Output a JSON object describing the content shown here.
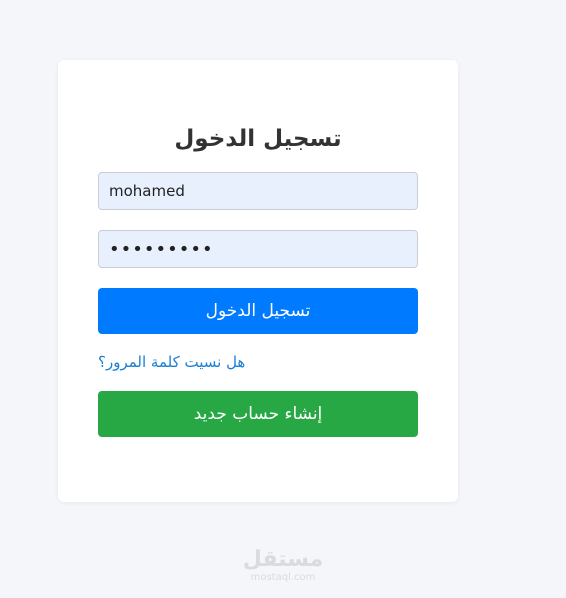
{
  "login_form": {
    "title": "تسجيل الدخول",
    "username_value": "mohamed",
    "password_value": "•••••••••",
    "login_button": "تسجيل الدخول",
    "forgot_link": "هل نسيت كلمة المرور؟",
    "register_button": "إنشاء حساب جديد"
  },
  "watermark": {
    "arabic": "مستقل",
    "latin": "mostaql.com"
  },
  "colors": {
    "primary": "#007bff",
    "success": "#28a745",
    "link": "#1a7fd4",
    "background": "#f4f6f9",
    "input_background": "#e8f0fe"
  }
}
